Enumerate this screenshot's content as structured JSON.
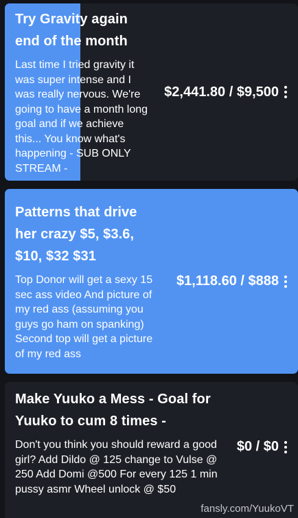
{
  "colors": {
    "background": "#121419",
    "card": "#1d1f26",
    "progress": "#5293f2",
    "text": "#ffffff"
  },
  "goals": [
    {
      "title": "Try Gravity again end of the month",
      "description": "Last time I tried gravity it was super intense and I was really nervous. We're going to have a month long goal and if we achieve this... You know what's happening - SUB ONLY STREAM -",
      "amount": "$2,441.80 / $9,500",
      "progress": 0.257,
      "menu_icon": "kebab-icon"
    },
    {
      "title": "Patterns that drive her crazy $5, $3.6, $10, $32 $31",
      "description": "Top Donor will get a sexy 15 sec ass video And picture of my red ass (assuming you guys go ham on spanking) Second top will get a picture of my red ass",
      "amount": "$1,118.60 / $888",
      "progress": 1.0,
      "menu_icon": "kebab-icon"
    },
    {
      "title": "Make Yuuko a Mess - Goal for Yuuko to cum 8 times -",
      "description": "Don't you think you should reward a good girl? Add Dildo @ 125 change to Vulse @ 250 Add Domi @500 For every 125 1 min pussy asmr Wheel unlock @ $50",
      "amount": "$0 / $0",
      "progress": 0.0,
      "menu_icon": "kebab-icon"
    }
  ],
  "watermark": "fansly.com/YuukoVT"
}
